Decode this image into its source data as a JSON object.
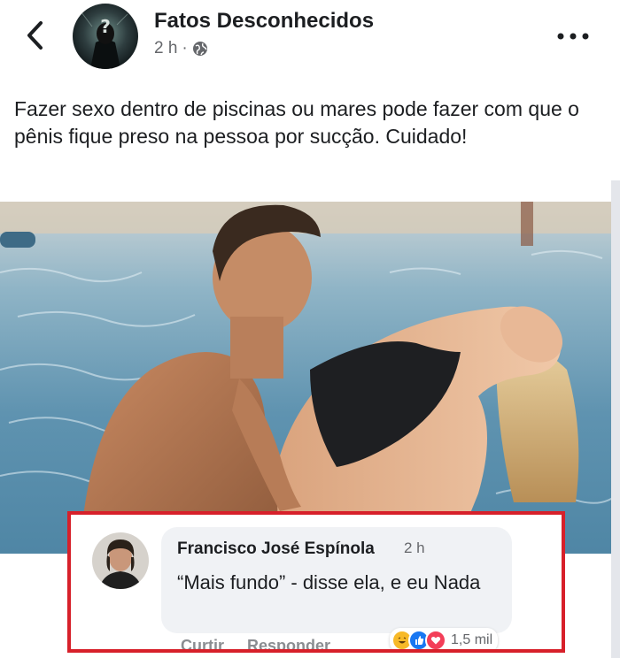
{
  "header": {
    "page_name": "Fatos Desconhecidos",
    "time": "2 h",
    "separator": "·"
  },
  "post": {
    "text": "Fazer sexo dentro de piscinas ou mares pode fazer com que o pênis fique preso na pessoa por sucção. Cuidado!"
  },
  "comment": {
    "author": "Francisco José Espínola",
    "time": "2 h",
    "text": "“Mais fundo” - disse ela, e eu Nada",
    "actions": {
      "like": "Curtir",
      "reply": "Responder"
    },
    "reactions": {
      "icons": [
        "haha-icon",
        "like-icon",
        "love-icon"
      ],
      "count": "1,5 mil"
    }
  },
  "colors": {
    "highlight_border": "#d7202a",
    "bubble_bg": "#f0f2f5",
    "secondary_text": "#65676b",
    "like_blue": "#1877f2",
    "love_red": "#f33e58",
    "haha_yellow": "#f7b928"
  }
}
